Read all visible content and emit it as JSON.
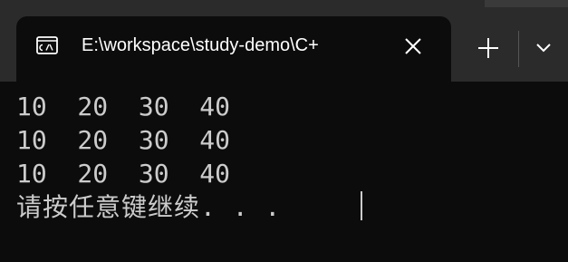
{
  "window": {
    "tab_title": "E:\\workspace\\study-demo\\C+",
    "tab_icon": "terminal-icon",
    "close_icon": "close-icon",
    "new_tab_icon": "plus-icon",
    "dropdown_icon": "chevron-down-icon",
    "colors": {
      "titlebar": "#2b2b2b",
      "terminal_bg": "#0c0c0c",
      "text": "#cccccc"
    }
  },
  "terminal": {
    "lines": [
      "10  20  30  40",
      "10  20  30  40",
      "10  20  30  40",
      "请按任意键继续. . ."
    ]
  }
}
